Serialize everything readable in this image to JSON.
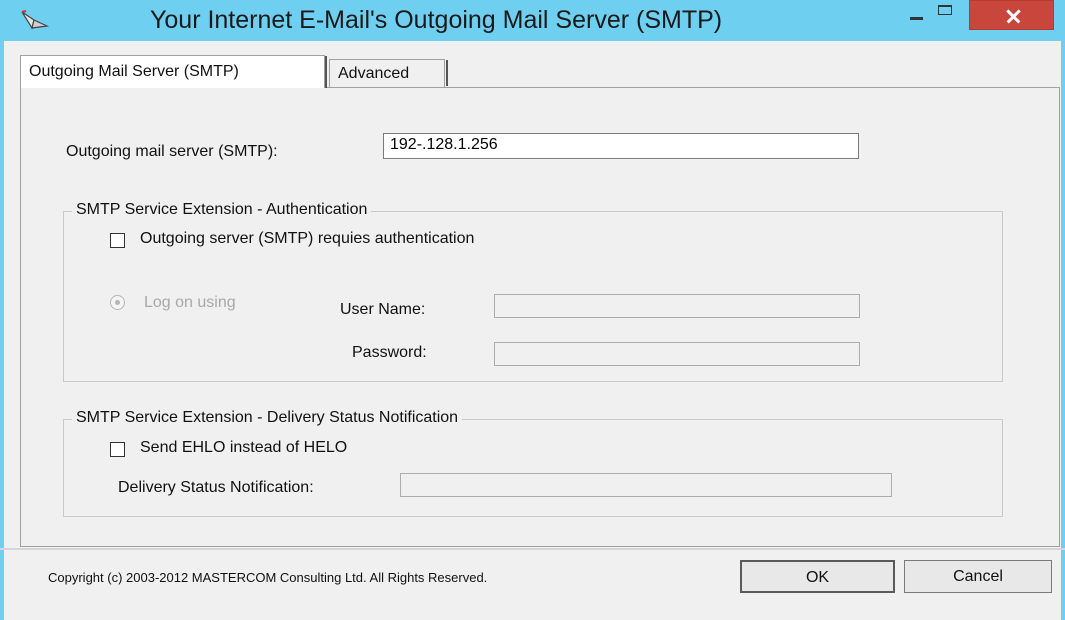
{
  "window": {
    "title": "Your Internet E-Mail's Outgoing Mail Server (SMTP)",
    "title_bar_color": "#6fcff0",
    "close_button_color": "#c9463d",
    "app_icon": "mail-send-icon",
    "minimize_icon": "minimize-icon",
    "maximize_icon": "maximize-icon",
    "close_icon": "close-icon"
  },
  "tabs": [
    {
      "label": "Outgoing Mail Server (SMTP)",
      "selected": true
    },
    {
      "label": "Advanced",
      "selected": false
    }
  ],
  "server": {
    "label": "Outgoing mail server (SMTP):",
    "value": "192-.128.1.256"
  },
  "auth_group": {
    "title": "SMTP Service Extension - Authentication",
    "requires_auth_label": "Outgoing server (SMTP) requies authentication",
    "requires_auth_checked": false,
    "logon_label": "Log on using",
    "username_label": "User Name:",
    "username_value": "",
    "password_label": "Password:",
    "password_value": ""
  },
  "dsn_group": {
    "title": "SMTP Service Extension - Delivery Status Notification",
    "ehlo_label": "Send EHLO instead of HELO",
    "ehlo_checked": false,
    "dsn_label": "Delivery Status Notification:",
    "dsn_value": ""
  },
  "footer": {
    "copyright": "Copyright (c) 2003-2012 MASTERCOM Consulting Ltd. All Rights Reserved.",
    "ok_label": "OK",
    "cancel_label": "Cancel"
  }
}
